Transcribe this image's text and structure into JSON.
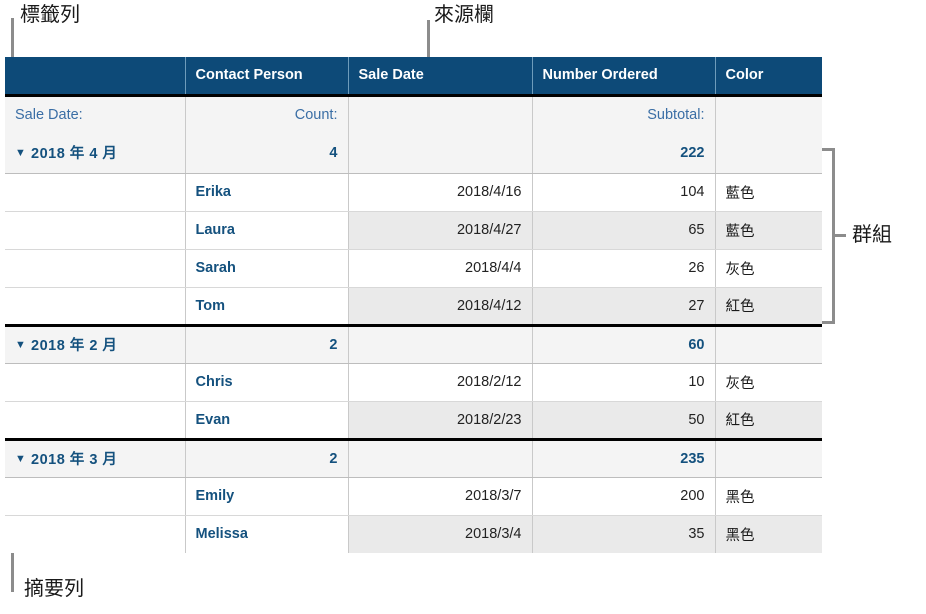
{
  "annotations": {
    "label_row": "標籤列",
    "source_column": "來源欄",
    "group": "群組",
    "summary_row": "摘要列"
  },
  "table": {
    "headers": [
      "",
      "Contact Person",
      "Sale Date",
      "Number Ordered",
      "Color"
    ],
    "summary_labels": {
      "group_field": "Sale Date:",
      "count": "Count:",
      "subtotal": "Subtotal:"
    },
    "groups": [
      {
        "name": "2018 年 4 月",
        "count": "4",
        "subtotal": "222",
        "rows": [
          {
            "contact": "Erika",
            "date": "2018/4/16",
            "number": "104",
            "color": "藍色"
          },
          {
            "contact": "Laura",
            "date": "2018/4/27",
            "number": "65",
            "color": "藍色"
          },
          {
            "contact": "Sarah",
            "date": "2018/4/4",
            "number": "26",
            "color": "灰色"
          },
          {
            "contact": "Tom",
            "date": "2018/4/12",
            "number": "27",
            "color": "紅色"
          }
        ]
      },
      {
        "name": "2018 年 2 月",
        "count": "2",
        "subtotal": "60",
        "rows": [
          {
            "contact": "Chris",
            "date": "2018/2/12",
            "number": "10",
            "color": "灰色"
          },
          {
            "contact": "Evan",
            "date": "2018/2/23",
            "number": "50",
            "color": "紅色"
          }
        ]
      },
      {
        "name": "2018 年 3 月",
        "count": "2",
        "subtotal": "235",
        "rows": [
          {
            "contact": "Emily",
            "date": "2018/3/7",
            "number": "200",
            "color": "黑色"
          },
          {
            "contact": "Melissa",
            "date": "2018/3/4",
            "number": "35",
            "color": "黑色"
          }
        ]
      }
    ]
  },
  "colors": {
    "header_bg": "#0d4a78",
    "accent_text": "#14517e",
    "summary_bg": "#f4f4f4",
    "alt_row_bg": "#eaeaea",
    "leader": "#8c8c8c"
  },
  "icons": {
    "disclosure": "▼"
  }
}
